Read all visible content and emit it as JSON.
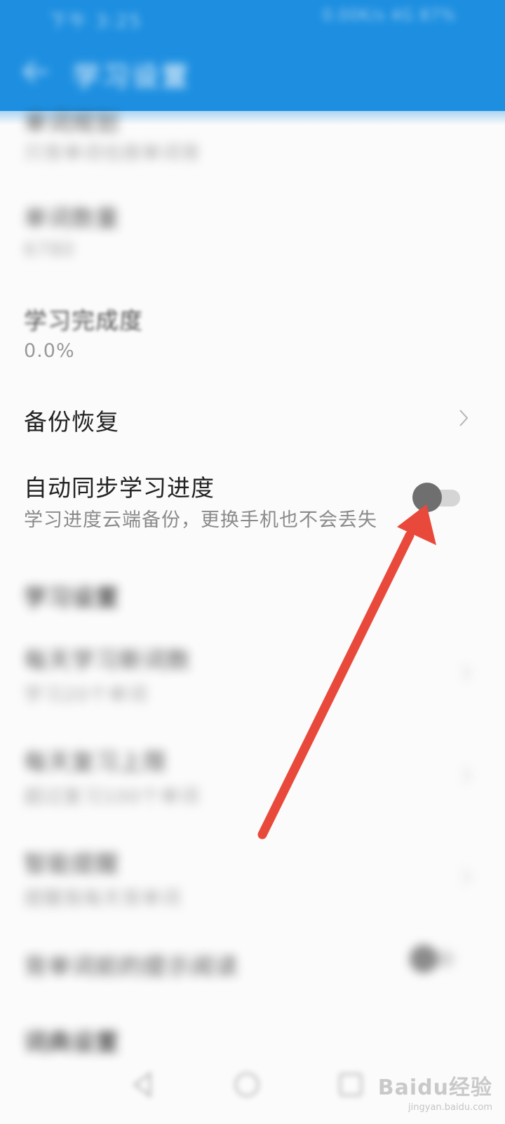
{
  "statusbar": {
    "left": "下午 3:25",
    "right": "0.00K/s 4G 87%"
  },
  "header": {
    "title": "学习设置"
  },
  "rows": [
    {
      "title": "单词规划",
      "subtitle": "只背单词也按单词背"
    },
    {
      "title": "单词数量",
      "subtitle": "6780"
    },
    {
      "title": "学习完成度",
      "subtitle": "0.0%"
    }
  ],
  "backup": {
    "title": "备份恢复"
  },
  "sync": {
    "title": "自动同步学习进度",
    "subtitle": "学习进度云端备份，更换手机也不会丢失",
    "enabled": false
  },
  "section": {
    "title": "学习设置"
  },
  "settings": [
    {
      "title": "每天学习新词数",
      "subtitle": "学习20个单词"
    },
    {
      "title": "每天复习上限",
      "subtitle": "超过复习100个单词"
    },
    {
      "title": "智能提醒",
      "subtitle": "提醒我每天背单词"
    },
    {
      "title": "背单词前的提示阅读"
    }
  ],
  "section2": {
    "title": "词典设置"
  },
  "watermark": {
    "logo": "Baidu经验",
    "url": "jingyan.baidu.com"
  },
  "colors": {
    "appbar": "#1e8fe0",
    "arrow": "#e8493b",
    "toggle_knob": "#6f6f6f"
  }
}
